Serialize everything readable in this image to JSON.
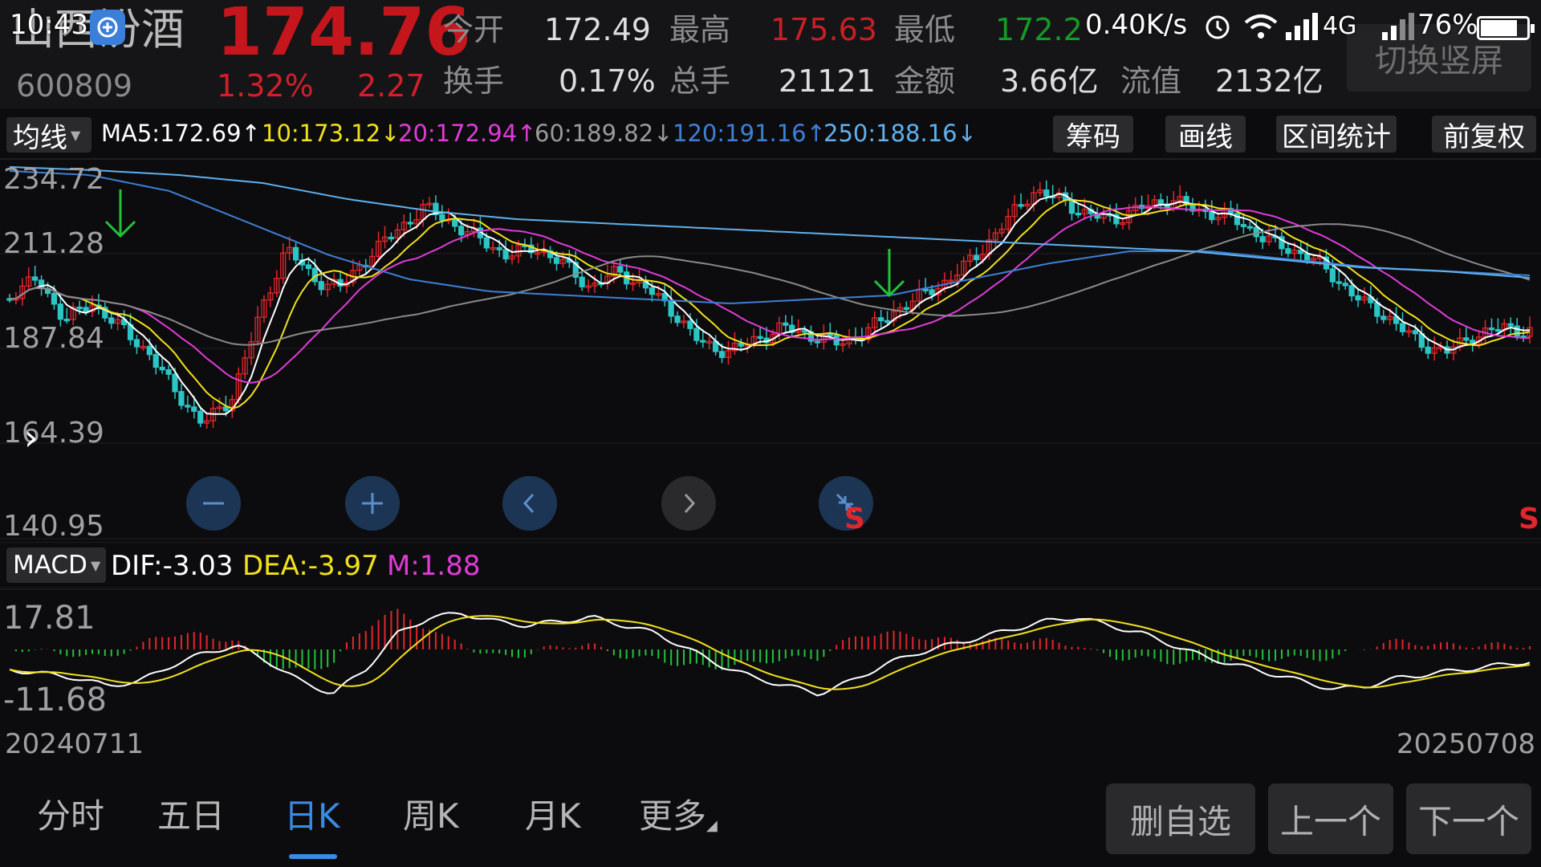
{
  "status": {
    "time": "10:43",
    "net_speed": "0.40K/s",
    "network": "4G",
    "battery": "76%"
  },
  "header": {
    "stock_name": "山西汾酒",
    "code": "600809",
    "price": "174.76",
    "change_pct": "1.32%",
    "change": "2.27",
    "row1": [
      {
        "label": "今开",
        "value": "172.49",
        "color": "#dddddd"
      },
      {
        "label": "最高",
        "value": "175.63",
        "color": "#c81f26"
      },
      {
        "label": "最低",
        "value": "172.2",
        "color": "#159a26"
      }
    ],
    "row2": [
      {
        "label": "换手",
        "value": "0.17%"
      },
      {
        "label": "总手",
        "value": "21121"
      },
      {
        "label": "金额",
        "value": "3.66亿"
      },
      {
        "label": "流值",
        "value": "2132亿"
      }
    ],
    "switch_button": "切换竖屏"
  },
  "ma_bar": {
    "selector": "均线",
    "items": [
      {
        "text": "MA5:172.69↑",
        "color": "#ffffff"
      },
      {
        "text": "10:173.12↓",
        "color": "#f2e01c"
      },
      {
        "text": "20:172.94↑",
        "color": "#e03bd8"
      },
      {
        "text": "60:189.82↓",
        "color": "#9a9a9a"
      },
      {
        "text": "120:191.16↑",
        "color": "#3e7fd6"
      },
      {
        "text": "250:188.16↓",
        "color": "#5fb1ee"
      }
    ],
    "tools": [
      "筹码",
      "画线",
      "区间统计",
      "前复权"
    ]
  },
  "kline_axis": {
    "labels": [
      "234.72",
      "211.28",
      "187.84",
      "164.39",
      "140.95"
    ]
  },
  "macd_bar": {
    "selector": "MACD",
    "dif": "DIF:-3.03",
    "dea": "DEA:-3.97",
    "m": "M:1.88",
    "axis_top": "17.81",
    "axis_bottom": "-11.68"
  },
  "dates": {
    "start": "20240711",
    "end": "20250708"
  },
  "signal_marker": "S",
  "tabs": [
    "分时",
    "五日",
    "日K",
    "周K",
    "月K",
    "更多"
  ],
  "active_tab": "日K",
  "buttons": {
    "remove": "删自选",
    "prev": "上一个",
    "next": "下一个"
  },
  "icons": [
    "zoom-out-icon",
    "zoom-in-icon",
    "scroll-left-icon",
    "scroll-right-icon",
    "collapse-icon",
    "expand-arrow-icon",
    "down-arrow-marker-icon"
  ],
  "colors": {
    "up": "#e2262c",
    "down": "#2bc5c5",
    "accent": "#3a8be6"
  }
}
